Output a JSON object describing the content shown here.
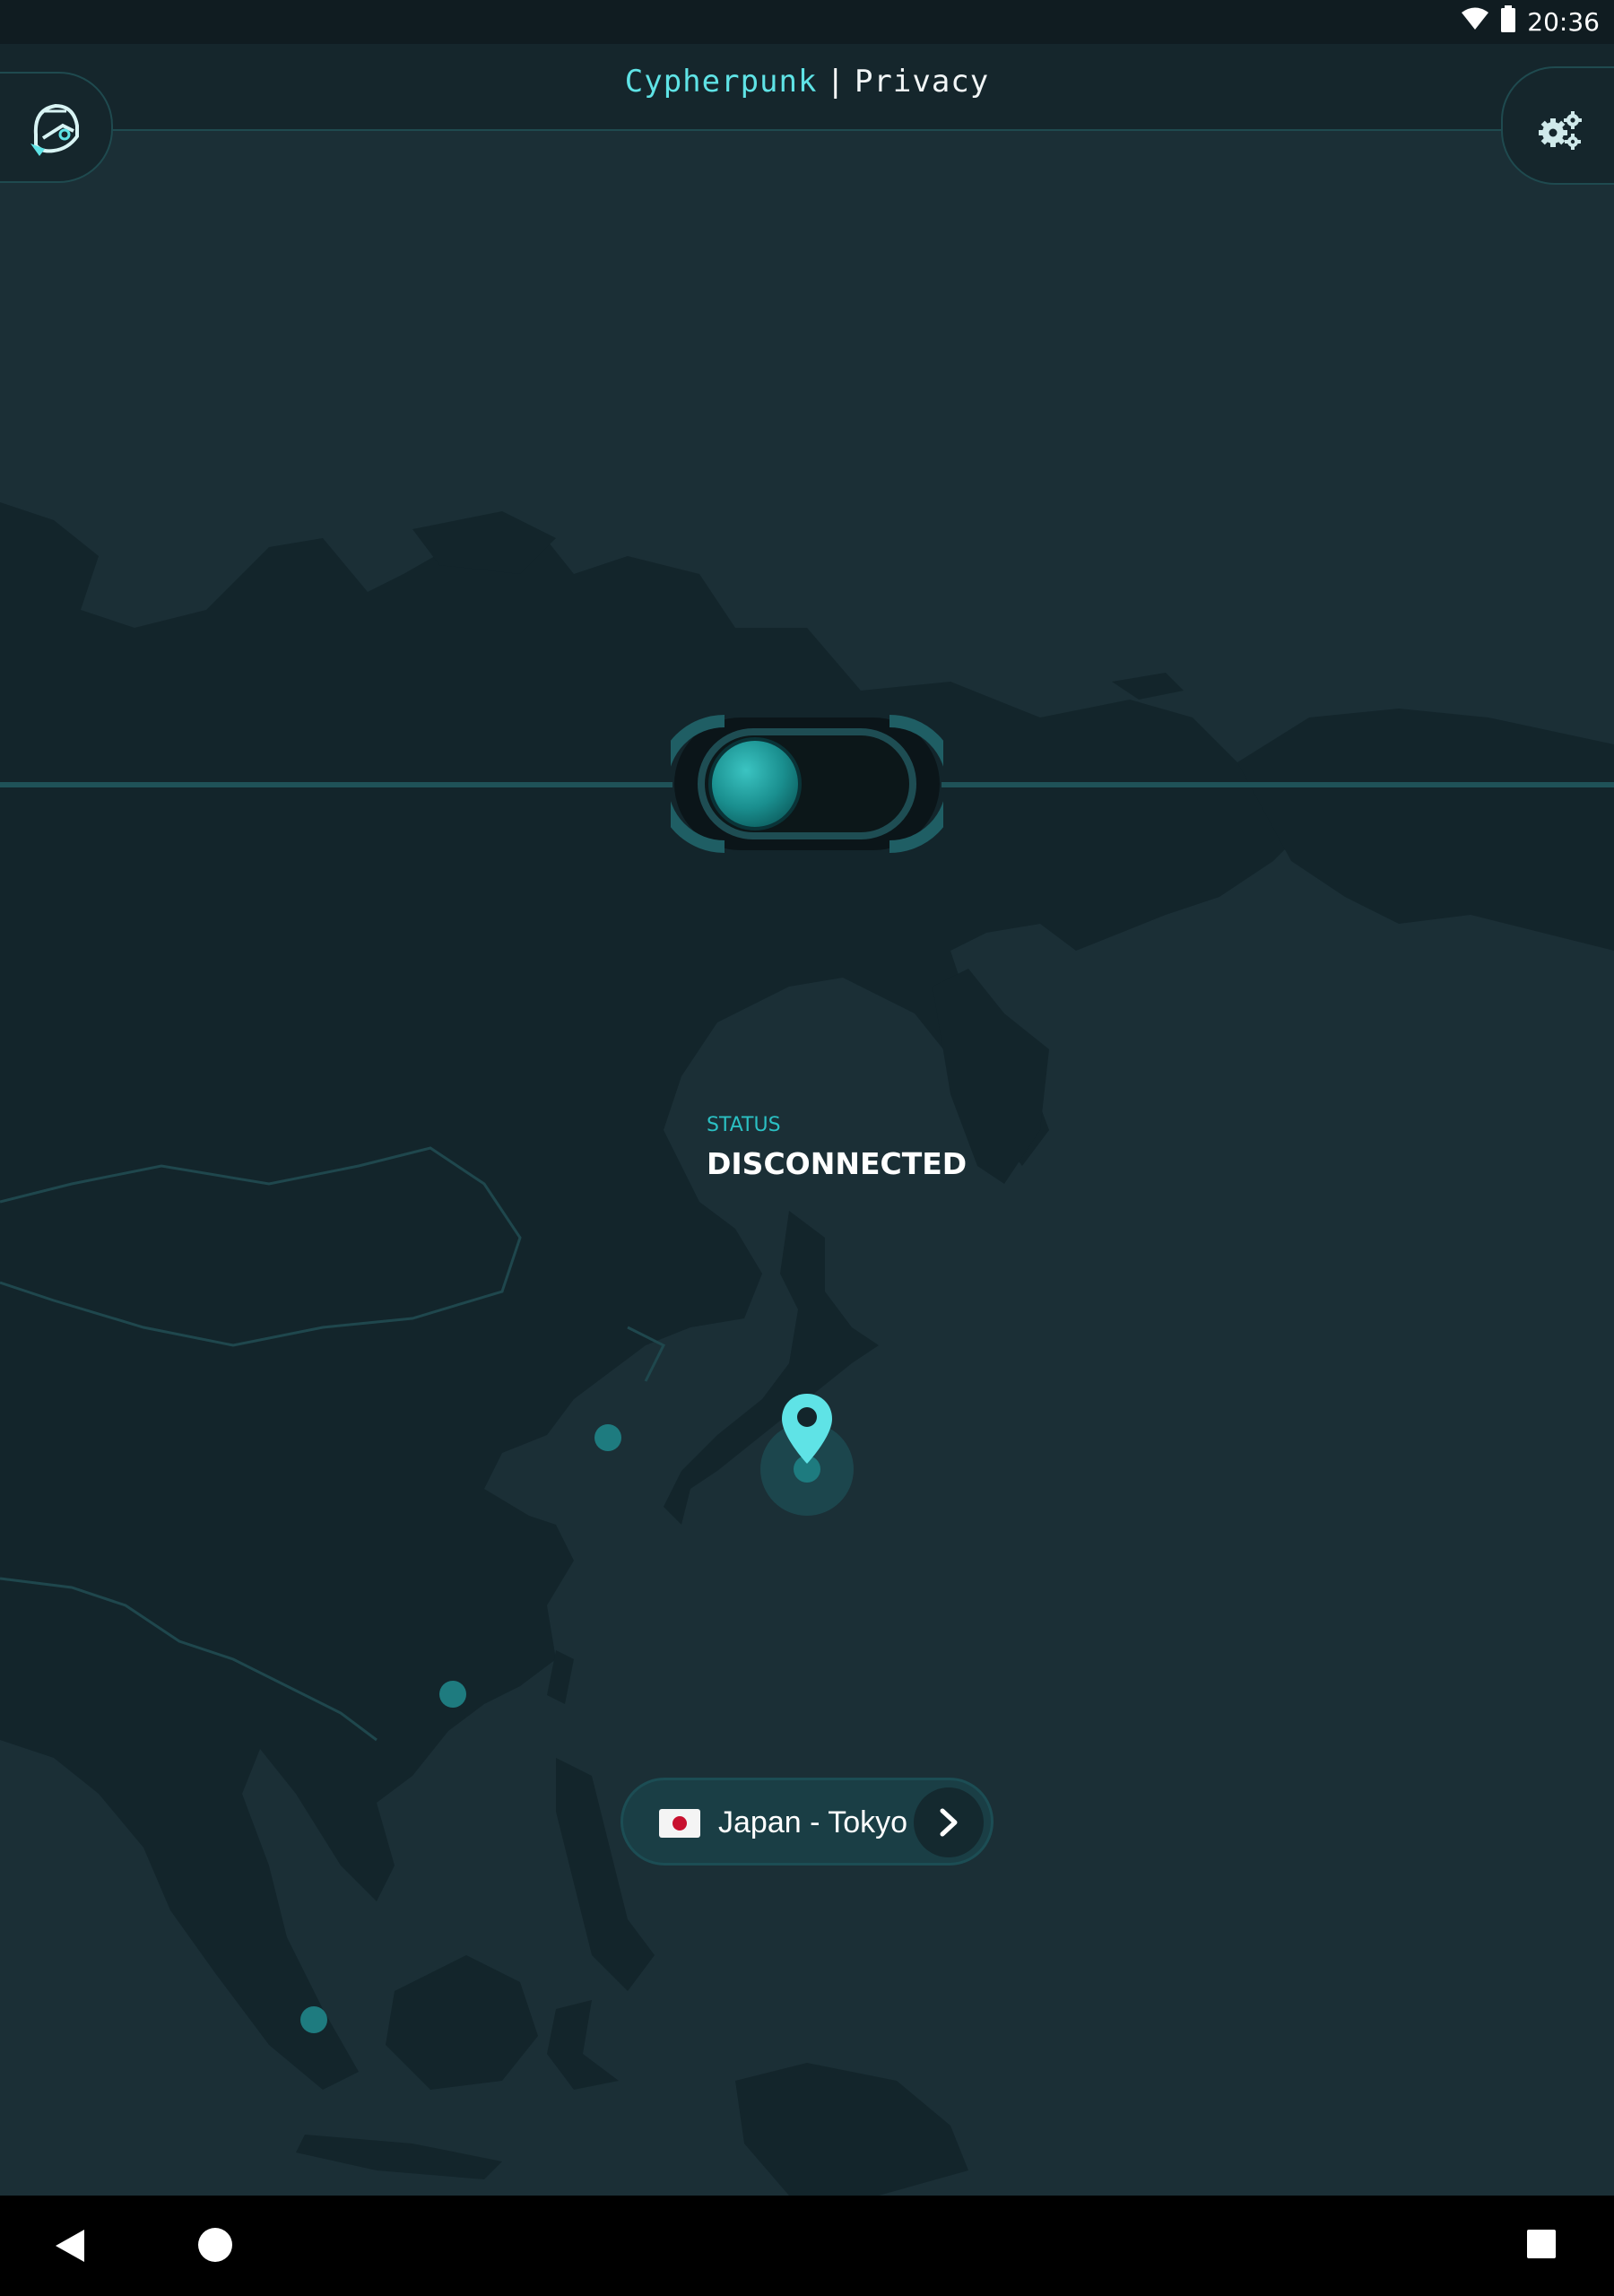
{
  "status_bar": {
    "time": "20:36"
  },
  "header": {
    "brand": "Cypherpunk",
    "separator": "|",
    "subtitle": "Privacy"
  },
  "icons": {
    "logo": "helmet-logo-icon",
    "settings": "gears-icon",
    "wifi": "wifi-icon",
    "battery": "battery-icon",
    "pin": "map-pin-icon",
    "chevron": "chevron-right-icon",
    "back": "back-icon",
    "home": "home-icon",
    "recents": "recents-icon"
  },
  "vpn": {
    "status_label": "STATUS",
    "status_value": "DISCONNECTED",
    "connected": false
  },
  "location": {
    "label": "Japan - Tokyo",
    "flag": "japan-flag"
  },
  "colors": {
    "accent": "#5fe3e6",
    "background": "#1b2f36",
    "land": "#13252b",
    "server_dot": "#1e7b7f"
  }
}
